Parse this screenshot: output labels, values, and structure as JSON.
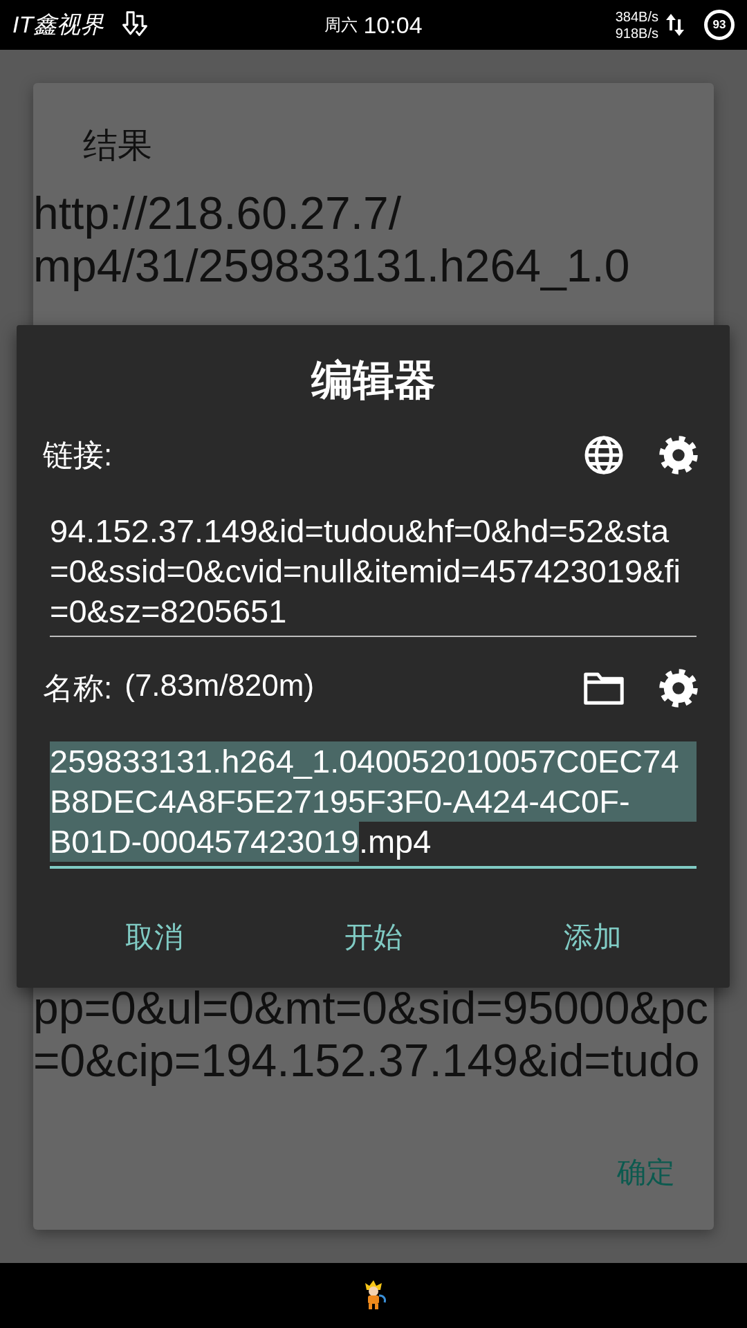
{
  "status_bar": {
    "app_title": "IT鑫视界",
    "weekday": "周六",
    "time": "10:04",
    "upload_speed": "384B/s",
    "download_speed": "918B/s",
    "battery": "93"
  },
  "result_dialog": {
    "title": "结果",
    "text_top": [
      "http://218.60.27.7/",
      "mp4/31/259833131.h264_1.0"
    ],
    "text_bottom": [
      "pp=0&ul=0&mt=0&sid=95000&pc",
      "=0&cip=194.152.37.149&id=tudo"
    ],
    "button": "确定"
  },
  "editor_dialog": {
    "title": "编辑器",
    "link_label": "链接:",
    "link_lines": [
      "94.152.37.149&id=tudou&hf=0&hd=52&sta",
      "=0&ssid=0&cvid=null&itemid=457423019&fi",
      "=0&sz=8205651"
    ],
    "name_label": "名称:",
    "size_info": "(7.83m/820m)",
    "name_lines": [
      [
        {
          "text": "259833131.h264_1.040052010057C0EC74",
          "selected": true
        }
      ],
      [
        {
          "text": "B8DEC4A8F5E27195F3F0-A424-4C0F-",
          "selected": true
        }
      ],
      [
        {
          "text": "B01D-000457423019",
          "selected": true
        },
        {
          "text": ".mp4",
          "selected": false
        }
      ]
    ],
    "buttons": [
      "取消",
      "开始",
      "添加"
    ]
  }
}
